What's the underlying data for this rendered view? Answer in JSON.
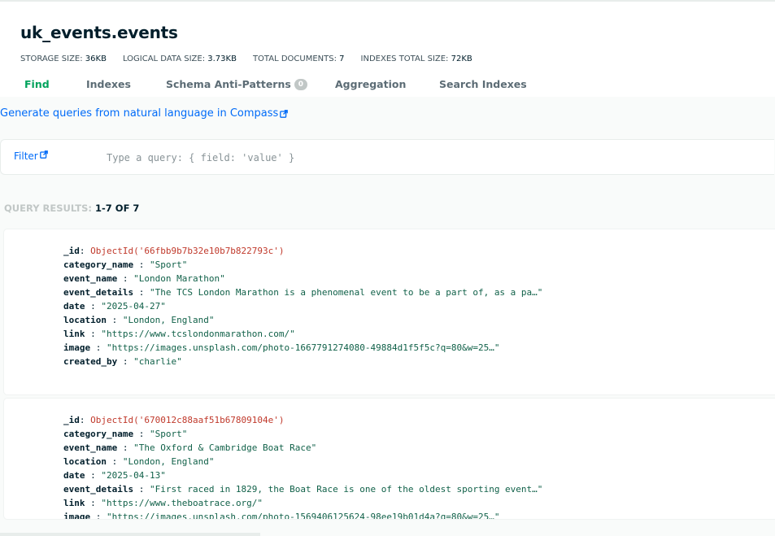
{
  "header": {
    "title": "uk_events.events"
  },
  "stats": [
    {
      "label": "STORAGE SIZE: ",
      "value": "36KB"
    },
    {
      "label": "LOGICAL DATA SIZE: ",
      "value": "3.73KB"
    },
    {
      "label": "TOTAL DOCUMENTS: ",
      "value": "7"
    },
    {
      "label": "INDEXES TOTAL SIZE: ",
      "value": "72KB"
    }
  ],
  "tabs": {
    "find": "Find",
    "indexes": "Indexes",
    "schema": "Schema Anti-Patterns",
    "schema_count": "0",
    "aggregation": "Aggregation",
    "search_indexes": "Search Indexes",
    "active": "find"
  },
  "nl_link": "Generate queries from natural language in Compass",
  "filter": {
    "label": "Filter",
    "placeholder": "Type a query: { field: 'value' }",
    "value": ""
  },
  "results": {
    "label": "QUERY RESULTS: ",
    "value": "1-7 OF 7"
  },
  "documents": [
    {
      "fields": [
        {
          "key": "_id",
          "sep": ": ",
          "value": "ObjectId('66fbb9b7b32e10b7b822793c')",
          "type": "oid"
        },
        {
          "key": "category_name",
          "sep": " : ",
          "value": "\"Sport\"",
          "type": "str"
        },
        {
          "key": "event_name",
          "sep": " : ",
          "value": "\"London Marathon\"",
          "type": "str"
        },
        {
          "key": "event_details",
          "sep": " : ",
          "value": "\"The TCS London Marathon is a phenomenal event to be a part of, as a pa…\"",
          "type": "str"
        },
        {
          "key": "date",
          "sep": " : ",
          "value": "\"2025-04-27\"",
          "type": "str"
        },
        {
          "key": "location",
          "sep": " : ",
          "value": "\"London, England\"",
          "type": "str"
        },
        {
          "key": "link",
          "sep": " : ",
          "value": "\"https://www.tcslondonmarathon.com/\"",
          "type": "str"
        },
        {
          "key": "image",
          "sep": " : ",
          "value": "\"https://images.unsplash.com/photo-1667791274080-49884d1f5f5c?q=80&w=25…\"",
          "type": "str"
        },
        {
          "key": "created_by",
          "sep": " : ",
          "value": "\"charlie\"",
          "type": "str"
        }
      ]
    },
    {
      "fields": [
        {
          "key": "_id",
          "sep": ": ",
          "value": "ObjectId('670012c88aaf51b67809104e')",
          "type": "oid"
        },
        {
          "key": "category_name",
          "sep": " : ",
          "value": "\"Sport\"",
          "type": "str"
        },
        {
          "key": "event_name",
          "sep": " : ",
          "value": "\"The Oxford & Cambridge Boat Race\"",
          "type": "str"
        },
        {
          "key": "location",
          "sep": " : ",
          "value": "\"London, England\"",
          "type": "str"
        },
        {
          "key": "date",
          "sep": " : ",
          "value": "\"2025-04-13\"",
          "type": "str"
        },
        {
          "key": "event_details",
          "sep": " : ",
          "value": "\"First raced in 1829, the Boat Race is one of the oldest sporting event…\"",
          "type": "str"
        },
        {
          "key": "link",
          "sep": " : ",
          "value": "\"https://www.theboatrace.org/\"",
          "type": "str"
        },
        {
          "key": "image",
          "sep": " : ",
          "value": "\"https://images.unsplash.com/photo-1569406125624-98ee19b01d4a?q=80&w=25…\"",
          "type": "str"
        }
      ]
    }
  ],
  "colors": {
    "accent": "#00a35c",
    "link": "#016bf8",
    "oid": "#c0392b",
    "string": "#116149"
  },
  "icons": {
    "external": "external-link-icon"
  }
}
